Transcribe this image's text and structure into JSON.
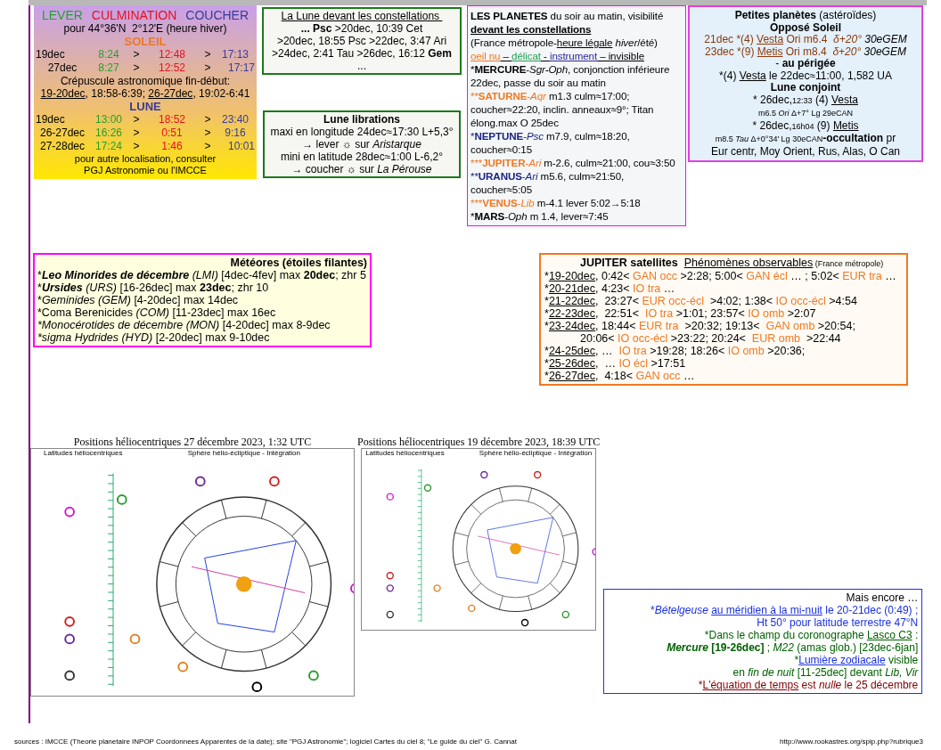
{
  "rise_set": {
    "header": [
      {
        "text": "LEVER",
        "color": "#22a030"
      },
      {
        "text": "CULMINATION",
        "color": "#e81020"
      },
      {
        "text": "COUCHER",
        "color": "#3a3a9a"
      }
    ],
    "location": "pour 44°36'N  2°12'E (heure hiver)",
    "sun": {
      "title": "SOLEIL",
      "rows": [
        [
          "19dec",
          "8:24",
          ">",
          "12:48",
          ">",
          "17:13"
        ],
        [
          "27dec",
          "8:27",
          ">",
          "12:52",
          ">",
          "17:17"
        ]
      ]
    },
    "twilight": {
      "label": "Crépuscule astronomique fin-début:",
      "segments": [
        {
          "text": "19-20dec",
          "kind": "underline"
        },
        {
          "text": ", 18:58-6:39; ",
          "kind": "plain"
        },
        {
          "text": "26-27dec",
          "kind": "underline"
        },
        {
          "text": ", 19:02-6:41",
          "kind": "plain"
        }
      ]
    },
    "moon": {
      "title": "LUNE",
      "rows": [
        [
          "19dec",
          "13:00",
          ">",
          "18:52",
          ">",
          "23:40"
        ],
        [
          "26-27dec",
          "16:26",
          ">",
          "0:51",
          ">",
          "9:16"
        ],
        [
          "27-28dec",
          "17:24",
          ">",
          "1:46",
          ">",
          "10:01"
        ]
      ]
    },
    "note": [
      "pour autre localisation, consulter",
      "PGJ Astronomie ou l'IMCCE"
    ]
  },
  "moon_constellations": [
    [
      {
        "text": "La Lune devant les constellations ",
        "kind": "underline"
      }
    ],
    [
      {
        "text": "... Psc",
        "kind": "bold"
      },
      {
        "text": " >20dec, 10:39 Cet",
        "kind": "plain"
      }
    ],
    [
      {
        "text": ">20dec, 18:55 Psc >22dec, 3:47 Ari",
        "kind": "plain"
      }
    ],
    [
      {
        "text": ">24dec, 2:41 Tau >26dec, 16:12 ",
        "kind": "plain"
      },
      {
        "text": "Gem",
        "kind": "bold"
      },
      {
        "text": " ...",
        "kind": "plain"
      }
    ]
  ],
  "librations": [
    [
      {
        "text": "Lune librations",
        "kind": "bold"
      }
    ],
    [
      {
        "text": "maxi en longitude 24dec≈17:30 L+5,3°",
        "kind": "plain"
      }
    ],
    [
      {
        "text": "→ lever ☼ sur ",
        "kind": "plain"
      },
      {
        "text": "Aristarque",
        "kind": "italic"
      }
    ],
    [
      {
        "text": "mini en latitude 28dec≈1:00 L-6,2°",
        "kind": "plain"
      }
    ],
    [
      {
        "text": "→ coucher ☼ sur ",
        "kind": "plain"
      },
      {
        "text": "La Pérouse",
        "kind": "italic"
      }
    ]
  ],
  "planets": [
    [
      {
        "text": "LES PLANETES",
        "kind": "bold"
      },
      {
        "text": " du soir au matin, visibilité",
        "kind": "plain"
      }
    ],
    [
      {
        "text": "devant les constellations",
        "kind": "boldunderline"
      }
    ],
    [
      {
        "text": "(France métropole-",
        "kind": "plain"
      },
      {
        "text": "heure légale",
        "kind": "underline"
      },
      {
        "text": " hiver",
        "kind": "italic"
      },
      {
        "text": "/été)",
        "kind": "plain"
      }
    ],
    [
      {
        "text": "oeil nu",
        "kind": "underline",
        "color": "#f07820"
      },
      {
        "text": " – ",
        "kind": "underline"
      },
      {
        "text": "délicat",
        "kind": "underline",
        "color": "#20a050"
      },
      {
        "text": " - ",
        "kind": "underline"
      },
      {
        "text": "instrument",
        "kind": "underline",
        "color": "#2a2a9a"
      },
      {
        "text": " – invisible",
        "kind": "underline"
      }
    ],
    [
      {
        "text": "*",
        "kind": "plain"
      },
      {
        "text": "MERCURE",
        "kind": "bold"
      },
      {
        "text": "-",
        "kind": "plain"
      },
      {
        "text": "Sgr-Oph",
        "kind": "italic"
      },
      {
        "text": ", conjonction inférieure 22dec, passe du soir au matin",
        "kind": "plain"
      }
    ],
    [
      {
        "color": "#f07820",
        "parts": [
          {
            "text": "**",
            "kind": "plain"
          },
          {
            "text": "SATURNE",
            "kind": "bold"
          },
          {
            "text": "-",
            "kind": "plain"
          },
          {
            "text": "Aqr",
            "kind": "italic"
          }
        ]
      },
      {
        "text": " m1.3 culm≈17:00; coucher≈22:20, inclin. anneaux≈9°; Titan élong.max O 25dec",
        "kind": "plain"
      }
    ],
    [
      {
        "color": "#1a237e",
        "parts": [
          {
            "text": "*",
            "kind": "plain"
          },
          {
            "text": "NEPTUNE",
            "kind": "bold"
          },
          {
            "text": "-",
            "kind": "plain"
          },
          {
            "text": "Psc",
            "kind": "italic"
          }
        ]
      },
      {
        "text": " m7.9, culm≈18:20, coucher≈0:15",
        "kind": "plain"
      }
    ],
    [
      {
        "color": "#f07820",
        "parts": [
          {
            "text": "***",
            "kind": "plain"
          },
          {
            "text": "JUPITER",
            "kind": "bold"
          },
          {
            "text": "-",
            "kind": "plain"
          },
          {
            "text": "Ari",
            "kind": "italic"
          }
        ]
      },
      {
        "text": " m-2.6, culm≈21:00, cou≈3:50",
        "kind": "plain"
      }
    ],
    [
      {
        "color": "#1a237e",
        "parts": [
          {
            "text": "**",
            "kind": "plain"
          },
          {
            "text": "URANUS",
            "kind": "bold"
          },
          {
            "text": "-",
            "kind": "plain"
          },
          {
            "text": "Ari",
            "kind": "italic"
          }
        ]
      },
      {
        "text": " m5.6, culm≈21:50, coucher≈5:05",
        "kind": "plain"
      }
    ],
    [
      {
        "color": "#f07820",
        "parts": [
          {
            "text": "***",
            "kind": "plain"
          },
          {
            "text": "VENUS",
            "kind": "bold"
          },
          {
            "text": "-",
            "kind": "plain"
          },
          {
            "text": "Lib",
            "kind": "italic"
          }
        ]
      },
      {
        "text": " m-4.1 lever 5:02→5:18",
        "kind": "plain"
      }
    ],
    [
      {
        "text": "*",
        "kind": "plain"
      },
      {
        "text": "MARS",
        "kind": "bold"
      },
      {
        "text": "-",
        "kind": "plain"
      },
      {
        "text": "Oph",
        "kind": "italic"
      },
      {
        "text": " m 1.4, lever≈7:45",
        "kind": "plain"
      }
    ]
  ],
  "minor_planets": [
    [
      {
        "text": "Petites planètes",
        "kind": "bold"
      },
      {
        "text": " (astéroïdes)",
        "kind": "plain"
      }
    ],
    [
      {
        "text": "Opposé Soleil",
        "kind": "bold"
      }
    ],
    [
      {
        "text": "21dec *(4) ",
        "kind": "plain",
        "color": "#8b3a0a"
      },
      {
        "text": "Vesta",
        "kind": "underline",
        "color": "#8b3a0a"
      },
      {
        "text": " Ori m6.4  ",
        "kind": "plain",
        "color": "#8b3a0a"
      },
      {
        "text": "δ+20°",
        "kind": "italic",
        "color": "#8b3a0a"
      },
      {
        "text": " 30eGEM",
        "kind": "italic"
      }
    ],
    [
      {
        "text": "23dec *(9) ",
        "kind": "plain",
        "color": "#8b3a0a"
      },
      {
        "text": "Metis",
        "kind": "underline",
        "color": "#8b3a0a"
      },
      {
        "text": " Ori m8.4  ",
        "kind": "plain",
        "color": "#8b3a0a"
      },
      {
        "text": "δ+20°",
        "kind": "italic",
        "color": "#8b3a0a"
      },
      {
        "text": " 30eGEM",
        "kind": "italic"
      }
    ],
    [
      {
        "text": "- ",
        "kind": "plain"
      },
      {
        "text": "au périgée",
        "kind": "bold"
      }
    ],
    [
      {
        "text": "*(4) ",
        "kind": "plain"
      },
      {
        "text": "Vesta",
        "kind": "underline"
      },
      {
        "text": " le 22dec≈11:00, 1,582 UA",
        "kind": "plain"
      }
    ],
    [
      {
        "text": "Lune conjoint",
        "kind": "bold"
      }
    ],
    [
      {
        "text": "* 26dec,",
        "kind": "plain"
      },
      {
        "text": "12:33",
        "kind": "small"
      },
      {
        "text": " (4) ",
        "kind": "plain"
      },
      {
        "text": "Vesta",
        "kind": "underline"
      }
    ],
    [
      {
        "text": "m6.5 ",
        "kind": "small"
      },
      {
        "text": "Ori",
        "kind": "smallitalic"
      },
      {
        "text": " Δ+7° Lg 29eCAN",
        "kind": "small"
      }
    ],
    [
      {
        "text": "* 26dec,",
        "kind": "plain"
      },
      {
        "text": "16h04",
        "kind": "small"
      },
      {
        "text": " (9) ",
        "kind": "plain"
      },
      {
        "text": "Metis",
        "kind": "underline"
      }
    ],
    [
      {
        "text": "m8.5 ",
        "kind": "small"
      },
      {
        "text": "Tau",
        "kind": "smallitalic"
      },
      {
        "text": " Δ+0°34' Lg 30eCAN",
        "kind": "small"
      },
      {
        "text": "-occultation",
        "kind": "bold"
      },
      {
        "text": " pr",
        "kind": "plain"
      }
    ],
    [
      {
        "text": "Eur centr, Moy Orient, Rus, Alas, O Can",
        "kind": "plain"
      }
    ]
  ],
  "meteors": {
    "title": "Météores (étoiles filantes)",
    "lines": [
      [
        {
          "text": "*",
          "kind": "plain"
        },
        {
          "text": "Leo Minorides de décembre",
          "kind": "bolditalic"
        },
        {
          "text": " (LMI)",
          "kind": "italic"
        },
        {
          "text": " [4dec-4fev] max ",
          "kind": "plain"
        },
        {
          "text": "20dec",
          "kind": "bold"
        },
        {
          "text": "; zhr 5",
          "kind": "plain"
        }
      ],
      [
        {
          "text": "*",
          "kind": "plain"
        },
        {
          "text": "Ursides",
          "kind": "bolditalic"
        },
        {
          "text": " (URS)",
          "kind": "italic"
        },
        {
          "text": " [16-26dec] max ",
          "kind": "plain"
        },
        {
          "text": "23dec",
          "kind": "bold"
        },
        {
          "text": "; zhr 10",
          "kind": "plain"
        }
      ],
      [
        {
          "text": "*",
          "kind": "plain"
        },
        {
          "text": "Geminides (GEM)",
          "kind": "italic"
        },
        {
          "text": " [4-20dec] max 14dec",
          "kind": "plain"
        }
      ],
      [
        {
          "text": "*Coma Berenicides ",
          "kind": "plain"
        },
        {
          "text": "(COM)",
          "kind": "italic"
        },
        {
          "text": " [11-23dec] max 16ec",
          "kind": "plain"
        }
      ],
      [
        {
          "text": "*Monocérotides de décembre (MON)",
          "kind": "italic"
        },
        {
          "text": " [4-20dec] max 8-9dec",
          "kind": "plain"
        }
      ],
      [
        {
          "text": "*sigma Hydrides (HYD)",
          "kind": "italic"
        },
        {
          "text": " [2-20dec] max 9-10dec",
          "kind": "plain"
        }
      ]
    ]
  },
  "jupiter": [
    {
      "indented": true,
      "segments": [
        {
          "text": "JUPITER satellites  ",
          "kind": "bold"
        },
        {
          "text": "Phénomènes observables",
          "kind": "underline"
        },
        {
          "text": " (France métropole)",
          "kind": "small"
        }
      ]
    },
    {
      "indented": false,
      "segments": [
        {
          "text": "*",
          "kind": "plain"
        },
        {
          "text": "19-20dec",
          "kind": "underline"
        },
        {
          "text": ", 0:42< ",
          "kind": "plain"
        },
        {
          "text": "GAN occ",
          "kind": "plain",
          "color": "#f07820"
        },
        {
          "text": " >2:28; 5:00< ",
          "kind": "plain"
        },
        {
          "text": "GAN écl",
          "kind": "plain",
          "color": "#f07820"
        },
        {
          "text": " … ; 5:02< ",
          "kind": "plain"
        },
        {
          "text": "EUR tra",
          "kind": "plain",
          "color": "#f07820"
        },
        {
          "text": " …",
          "kind": "plain"
        }
      ]
    },
    {
      "indented": false,
      "segments": [
        {
          "text": "*",
          "kind": "plain"
        },
        {
          "text": "20-21dec",
          "kind": "underline"
        },
        {
          "text": ", 4:23< ",
          "kind": "plain"
        },
        {
          "text": "IO tra",
          "kind": "plain",
          "color": "#f07820"
        },
        {
          "text": " …",
          "kind": "plain"
        }
      ]
    },
    {
      "indented": false,
      "segments": [
        {
          "text": "*",
          "kind": "plain"
        },
        {
          "text": "21-22dec",
          "kind": "underline"
        },
        {
          "text": ",  23:27< ",
          "kind": "plain"
        },
        {
          "text": "EUR occ-écl",
          "kind": "plain",
          "color": "#f07820"
        },
        {
          "text": "  >4:02; 1:38< ",
          "kind": "plain"
        },
        {
          "text": "IO occ-écl",
          "kind": "plain",
          "color": "#f07820"
        },
        {
          "text": " >4:54",
          "kind": "plain"
        }
      ]
    },
    {
      "indented": false,
      "segments": [
        {
          "text": "*",
          "kind": "plain"
        },
        {
          "text": "22-23dec",
          "kind": "underline"
        },
        {
          "text": ",  22:51<  ",
          "kind": "plain"
        },
        {
          "text": "IO tra",
          "kind": "plain",
          "color": "#f07820"
        },
        {
          "text": " >1:01; 23:57< ",
          "kind": "plain"
        },
        {
          "text": "IO omb",
          "kind": "plain",
          "color": "#f07820"
        },
        {
          "text": " >2:07",
          "kind": "plain"
        }
      ]
    },
    {
      "indented": false,
      "segments": [
        {
          "text": "*",
          "kind": "plain"
        },
        {
          "text": "23-24dec",
          "kind": "underline"
        },
        {
          "text": ", 18:44< ",
          "kind": "plain"
        },
        {
          "text": "EUR tra",
          "kind": "plain",
          "color": "#f07820"
        },
        {
          "text": "  >20:32; 19:13<  ",
          "kind": "plain"
        },
        {
          "text": "GAN omb",
          "kind": "plain",
          "color": "#f07820"
        },
        {
          "text": " >20:54;",
          "kind": "plain"
        }
      ]
    },
    {
      "indented": true,
      "segments": [
        {
          "text": "20:06< ",
          "kind": "plain"
        },
        {
          "text": "IO occ-écl",
          "kind": "plain",
          "color": "#f07820"
        },
        {
          "text": " >23:22; 20:24<  ",
          "kind": "plain"
        },
        {
          "text": "EUR omb",
          "kind": "plain",
          "color": "#f07820"
        },
        {
          "text": "  >22:44",
          "kind": "plain"
        }
      ]
    },
    {
      "indented": false,
      "segments": [
        {
          "text": "*",
          "kind": "plain"
        },
        {
          "text": "24-25dec",
          "kind": "underline"
        },
        {
          "text": ", …  ",
          "kind": "plain"
        },
        {
          "text": "IO tra",
          "kind": "plain",
          "color": "#f07820"
        },
        {
          "text": " >19:28; 18:26< ",
          "kind": "plain"
        },
        {
          "text": "IO omb",
          "kind": "plain",
          "color": "#f07820"
        },
        {
          "text": " >20:36;",
          "kind": "plain"
        }
      ]
    },
    {
      "indented": false,
      "segments": [
        {
          "text": "*",
          "kind": "plain"
        },
        {
          "text": "25-26dec",
          "kind": "underline"
        },
        {
          "text": ",  … ",
          "kind": "plain"
        },
        {
          "text": "IO écl",
          "kind": "plain",
          "color": "#f07820"
        },
        {
          "text": " >17:51",
          "kind": "plain"
        }
      ]
    },
    {
      "indented": false,
      "segments": [
        {
          "text": "*",
          "kind": "plain"
        },
        {
          "text": "26-27dec",
          "kind": "underline"
        },
        {
          "text": ",  4:18< ",
          "kind": "plain"
        },
        {
          "text": "GAN occ",
          "kind": "plain",
          "color": "#f07820"
        },
        {
          "text": " …",
          "kind": "plain"
        }
      ]
    }
  ],
  "diagrams": [
    {
      "title": "Positions héliocentriques 27 décembre 2023, 1:32 UTC",
      "left_label": "Latitudes héliocentriques",
      "right_label": "Sphère hélio-écliptique - Intégration"
    },
    {
      "title": "Positions héliocentriques 19 décembre 2023, 18:39 UTC",
      "left_label": "Latitudes héliocentriques",
      "right_label": "Sphère hélio-écliptique - Intégration"
    }
  ],
  "more_title": "Mais encore …",
  "more": [
    [
      {
        "color": "#1a30e0",
        "parts": [
          {
            "text": "*",
            "kind": "plain"
          },
          {
            "text": "Bételgeuse ",
            "kind": "italic"
          },
          {
            "text": "au méridien à la mi-nuit",
            "kind": "underline"
          },
          {
            "text": " le 20-21dec (0:49) ;",
            "kind": "plain"
          }
        ]
      }
    ],
    [
      {
        "color": "#1a30e0",
        "parts": [
          {
            "text": "Ht 50° pour latitude terrestre 47°N",
            "kind": "plain"
          }
        ]
      }
    ],
    [
      {
        "color": "#006000",
        "parts": [
          {
            "text": "*Dans le champ du coronographe ",
            "kind": "plain"
          },
          {
            "text": "Lasco C3",
            "kind": "underline"
          },
          {
            "text": " :",
            "kind": "plain"
          }
        ]
      }
    ],
    [
      {
        "color": "#006000",
        "parts": [
          {
            "text": "Mercure",
            "kind": "bolditalic"
          },
          {
            "text": " [19-26dec]",
            "kind": "bold"
          },
          {
            "text": " ; ",
            "kind": "plain"
          },
          {
            "text": "M22",
            "kind": "italic"
          },
          {
            "text": " (amas glob.) [23dec-6jan]",
            "kind": "plain"
          }
        ]
      }
    ],
    [
      {
        "color": "#006000",
        "parts": [
          {
            "text": "*",
            "kind": "plain"
          },
          {
            "color": "#1a30e0",
            "parts": [
              {
                "text": "Lumière zodiacale",
                "kind": "underline"
              }
            ]
          },
          {
            "text": " visible",
            "kind": "plain"
          }
        ]
      }
    ],
    [
      {
        "color": "#006000",
        "parts": [
          {
            "text": "en ",
            "kind": "plain"
          },
          {
            "text": "fin de nuit",
            "kind": "italic"
          },
          {
            "text": " [11-25dec] devant ",
            "kind": "plain"
          },
          {
            "text": "Lib, Vir",
            "kind": "italic"
          }
        ]
      }
    ],
    [
      {
        "color": "#800000",
        "parts": [
          {
            "text": "*",
            "kind": "plain"
          },
          {
            "text": "L'équation de temps",
            "kind": "underline"
          },
          {
            "text": " est ",
            "kind": "plain"
          },
          {
            "text": "nulle",
            "kind": "italic"
          },
          {
            "text": " le 25 décembre",
            "kind": "plain"
          }
        ]
      }
    ]
  ],
  "footer": {
    "sources": "sources : IMCCE (Theorie planetaire INPOP Coordonnees Apparentes de la date); site \"PGJ Astronomie\"; logiciel  Cartes du ciel 8; \"Le guide du ciel\" G. Cannat",
    "url": "http://www.rookastres.org/spip.php?rubrique3"
  }
}
